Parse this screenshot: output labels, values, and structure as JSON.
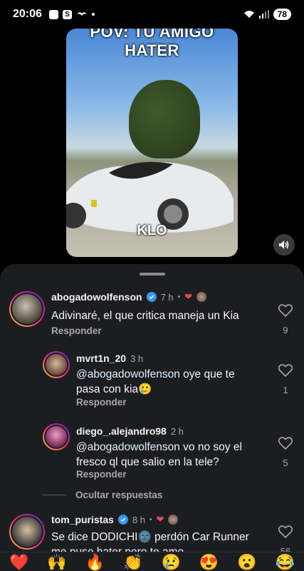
{
  "status_bar": {
    "time": "20:06",
    "battery": "78"
  },
  "video": {
    "title_line1": "POV: TU AMIGO",
    "title_line2": "HATER",
    "caption": "KLO"
  },
  "comments": [
    {
      "username": "abogadowolfenson",
      "verified": true,
      "time": "7 h",
      "text": "Adivinaré, el que critica maneja un Kia",
      "reply_label": "Responder",
      "likes": "9"
    },
    {
      "username": "mvrt1n_20",
      "time": "3 h",
      "mention": "@abogadowolfenson",
      "text_line1_rest": " oye que te",
      "text_line2": "pasa con kia🥲",
      "reply_label": "Responder",
      "likes": "1"
    },
    {
      "username": "diego_.alejandro98",
      "time": "2 h",
      "mention": "@abogadowolfenson",
      "text_line1_rest": " vo no soy el",
      "text_line2": "fresco ql que salio en la tele?",
      "reply_label": "Responder",
      "likes": "5"
    },
    {
      "username": "tom_puristas",
      "verified": true,
      "time": "8 h",
      "text_line1": "Se dice DODICHI🌚 perdón Car Runner",
      "text_line2": "me puse hater pero te amo",
      "likes": "56"
    }
  ],
  "hide_replies_label": "Ocultar respuestas",
  "emoji_bar": [
    "❤️",
    "🙌",
    "🔥",
    "👏",
    "😢",
    "😍",
    "😮",
    "😂"
  ],
  "colors": {
    "sheet_bg": "#1c1d21",
    "verified": "#3897f0",
    "heart": "#ed4956"
  }
}
